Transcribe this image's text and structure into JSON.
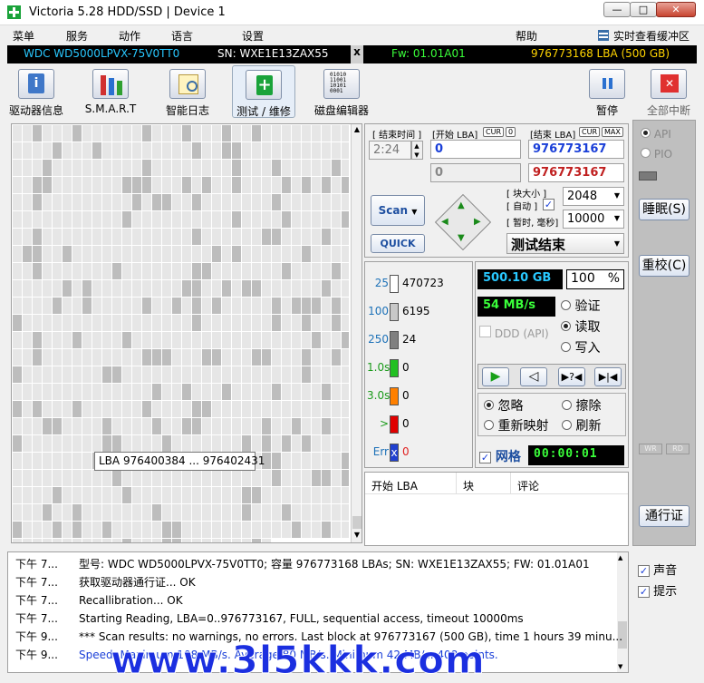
{
  "window": {
    "title": "Victoria 5.28 HDD/SSD | Device 1",
    "min": "—",
    "max": "□",
    "close": "✕"
  },
  "menu": {
    "items": [
      "菜单",
      "服务",
      "动作",
      "语言",
      "设置",
      "帮助"
    ],
    "live_cache": "实时查看缓冲区"
  },
  "device": {
    "model": "WDC WD5000LPVX-75V0TT0",
    "sn": "SN: WXE1E13ZAX55",
    "x": "x",
    "fw": "Fw: 01.01A01",
    "lba": "976773168 LBA (500 GB)"
  },
  "toolbar": {
    "items": [
      "驱动器信息",
      "S.M.A.R.T",
      "智能日志",
      "测试 / 维修",
      "磁盘编辑器"
    ],
    "pause": "暂停",
    "abort": "全部中断"
  },
  "tooltip": "LBA  976400384 ... 976402431",
  "scan": {
    "end_time_label": "[ 结束时间 ]",
    "start_lba_label": "[开始 LBA]",
    "cur": "CUR",
    "zero": "0",
    "end_lba_label": "[结束 LBA]",
    "max": "MAX",
    "time": "2:24",
    "start_lba": "0",
    "end_lba": "976773167",
    "start_lba2": "0",
    "end_lba2": "976773167",
    "block_size_label": "[ 块大小 ]",
    "auto_label": "[ 自动 ]",
    "block_size": "2048",
    "timeout_label": "[ 暂时, 毫秒]",
    "timeout": "10000",
    "scan_btn": "Scan",
    "quick_btn": "QUICK",
    "result": "测试结束"
  },
  "stats": {
    "rows": [
      {
        "t": "25",
        "c": "470723",
        "color": "#ffffff"
      },
      {
        "t": "100",
        "c": "6195",
        "color": "#c8c8c8"
      },
      {
        "t": "250",
        "c": "24",
        "color": "#808080"
      },
      {
        "t": "1.0s",
        "c": "0",
        "color": "#22c022"
      },
      {
        "t": "3.0s",
        "c": "0",
        "color": "#ff8000"
      },
      {
        "t": ">",
        "c": "0",
        "color": "#e00000"
      },
      {
        "t": "Err",
        "c": "0",
        "color": "#2040d0"
      }
    ]
  },
  "progress": {
    "size": "500.10 GB",
    "percent": "100",
    "pct_sign": "%",
    "speed": "54 MB/s",
    "ddd": "DDD (API)",
    "verify": "验证",
    "read": "读取",
    "write": "写入",
    "ignore": "忽略",
    "erase": "擦除",
    "remap": "重新映射",
    "refresh": "刷新",
    "grid": "网格",
    "timer": "00:00:01"
  },
  "side": {
    "api": "API",
    "pio": "PIO",
    "sleep": "睡眠(S)",
    "recal": "重校(C)",
    "wr": "WR",
    "rd": "RD",
    "passport": "通行证"
  },
  "errtable": {
    "headers": [
      "开始 LBA",
      "块",
      "评论"
    ]
  },
  "options": {
    "sound": "声音",
    "hints": "提示"
  },
  "log": [
    {
      "time": "下午 7...",
      "text": "型号: WDC WD5000LPVX-75V0TT0; 容量 976773168 LBAs; SN: WXE1E13ZAX55; FW: 01.01A01",
      "color": "#000000"
    },
    {
      "time": "下午 7...",
      "text": "获取驱动器通行证... OK",
      "color": "#000000"
    },
    {
      "time": "下午 7...",
      "text": "Recallibration... OK",
      "color": "#000000"
    },
    {
      "time": "下午 7...",
      "text": "Starting Reading, LBA=0..976773167, FULL, sequential access, timeout 10000ms",
      "color": "#000000"
    },
    {
      "time": "下午 9...",
      "text": "*** Scan results: no warnings, no errors. Last block at 976773167 (500 GB), time 1 hours 39 minu...",
      "color": "#000000"
    },
    {
      "time": "下午 9...",
      "text": "Speed: Maximum 108 MB/s. Average 80 MB/s. Minimum 42 MB/s. 408 points.",
      "color": "#1a3fd8"
    }
  ],
  "watermark": "www.3l5kkk.com"
}
